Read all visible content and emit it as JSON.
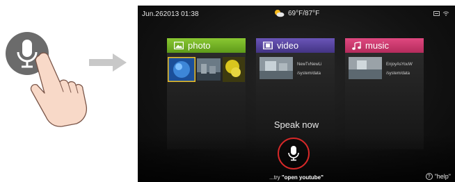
{
  "status_bar": {
    "datetime": "Jun.262013  01:38",
    "weather": "69°F/87°F"
  },
  "cards": {
    "photo": {
      "label": "photo"
    },
    "video": {
      "label": "video",
      "item_title": "NewTvNewLi",
      "item_path": "/system/data"
    },
    "music": {
      "label": "music",
      "item_title": "EnjoyAsYouW",
      "item_path": "/system/data"
    }
  },
  "voice": {
    "prompt": "Speak now",
    "hint_prefix": "...try ",
    "hint_command": "\"open youtube\"",
    "help_label": "\"help\""
  },
  "colors": {
    "photo_header": "#7ab82a",
    "video_header": "#5a47a4",
    "music_header": "#d43c70",
    "mic_ring": "#d62828",
    "badge_gray": "#6b6b6b",
    "arrow_gray": "#c8c8c8"
  }
}
